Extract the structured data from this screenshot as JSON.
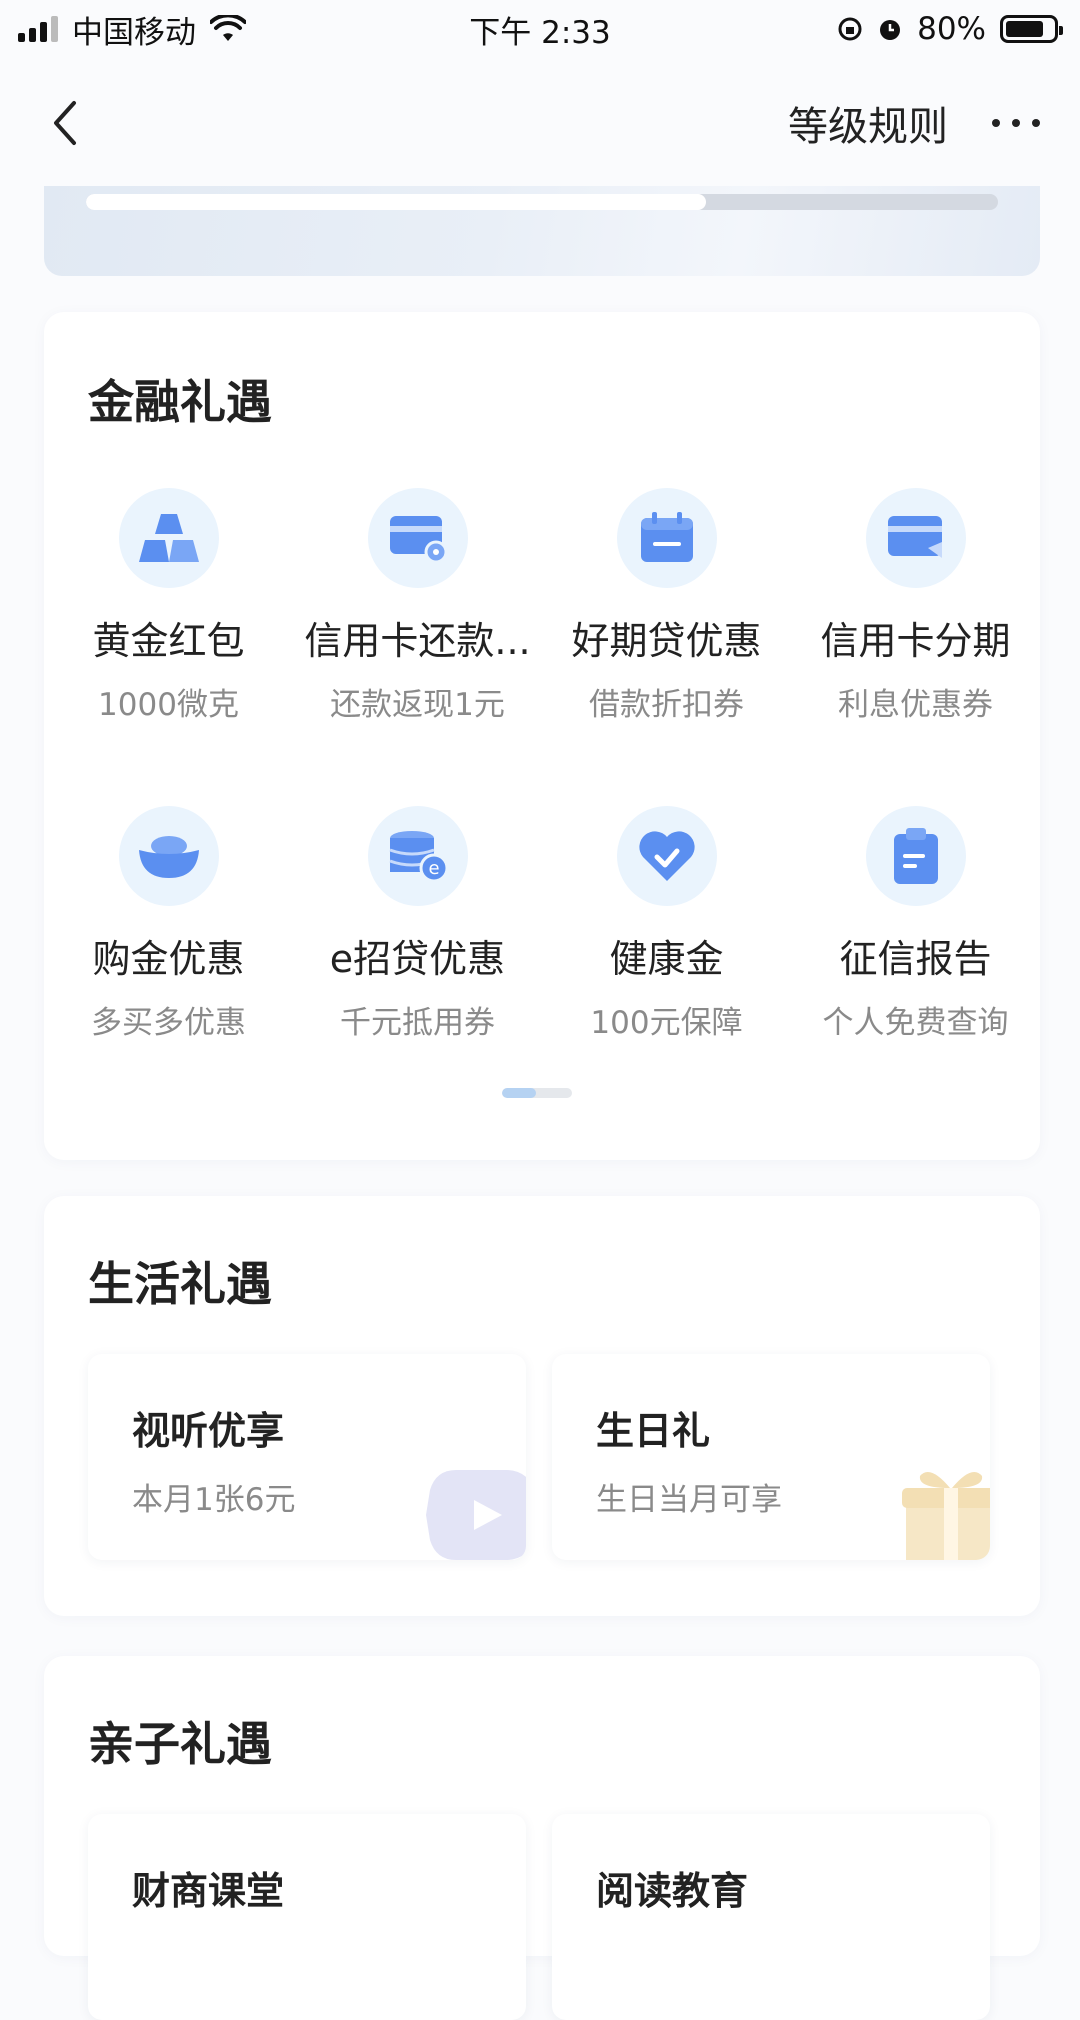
{
  "status_bar": {
    "carrier": "中国移动",
    "time": "下午 2:33",
    "battery": "80%",
    "battery_level": 0.8
  },
  "nav": {
    "rules_label": "等级规则"
  },
  "level_progress": 0.68,
  "finance": {
    "title": "金融礼遇",
    "items": [
      {
        "title": "黄金红包",
        "sub": "1000微克",
        "icon": "gold-bars-icon"
      },
      {
        "title": "信用卡还款...",
        "sub": "还款返现1元",
        "icon": "credit-card-repay-icon"
      },
      {
        "title": "好期贷优惠",
        "sub": "借款折扣券",
        "icon": "calendar-icon"
      },
      {
        "title": "信用卡分期",
        "sub": "利息优惠券",
        "icon": "card-installment-icon"
      },
      {
        "title": "购金优惠",
        "sub": "多买多优惠",
        "icon": "gold-ingot-icon"
      },
      {
        "title": "e招贷优惠",
        "sub": "千元抵用券",
        "icon": "coin-stack-icon"
      },
      {
        "title": "健康金",
        "sub": "100元保障",
        "icon": "heart-check-icon"
      },
      {
        "title": "征信报告",
        "sub": "个人免费查询",
        "icon": "clipboard-icon"
      }
    ],
    "page_index": 1,
    "page_count": 2
  },
  "life": {
    "title": "生活礼遇",
    "cards": [
      {
        "title": "视听优享",
        "sub": "本月1张6元",
        "icon": "play-icon"
      },
      {
        "title": "生日礼",
        "sub": "生日当月可享",
        "icon": "gift-icon"
      }
    ]
  },
  "family": {
    "title": "亲子礼遇",
    "cards": [
      {
        "title": "财商课堂"
      },
      {
        "title": "阅读教育"
      }
    ]
  },
  "colors": {
    "icon_blue": "#5b8ff0",
    "icon_bg": "#eaf4fd",
    "play_deco": "#e3e4f6",
    "gift_deco": "#f6e7c6"
  }
}
